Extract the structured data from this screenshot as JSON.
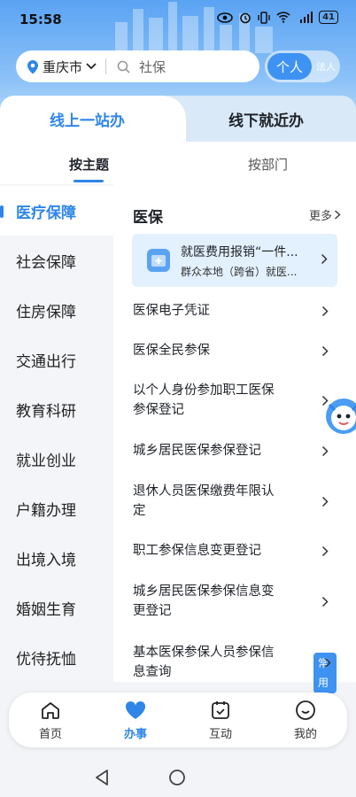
{
  "status_bar": {
    "time": "15:58",
    "battery": "41"
  },
  "search": {
    "city": "重庆市",
    "placeholder": "社保"
  },
  "role_toggle": {
    "active": "个人",
    "inactive": "法人"
  },
  "service_tabs": {
    "online": "线上一站办",
    "offline": "线下就近办"
  },
  "sub_tabs": {
    "by_topic": "按主题",
    "by_department": "按部门"
  },
  "sidebar": {
    "items": [
      {
        "label": "医疗保障"
      },
      {
        "label": "社会保障"
      },
      {
        "label": "住房保障"
      },
      {
        "label": "交通出行"
      },
      {
        "label": "教育科研"
      },
      {
        "label": "就业创业"
      },
      {
        "label": "户籍办理"
      },
      {
        "label": "出境入境"
      },
      {
        "label": "婚姻生育"
      },
      {
        "label": "优待抚恤"
      }
    ]
  },
  "main": {
    "section_title": "医保",
    "more": "更多",
    "featured": {
      "title": "就医费用报销“一件...",
      "subtitle": "群众本地（跨省）就医..."
    },
    "items": [
      {
        "line1": "医保电子凭证"
      },
      {
        "line1": "医保全民参保"
      },
      {
        "line1": "以个人身份参加职工医保",
        "line2": "参保登记"
      },
      {
        "line1": "城乡居民医保参保登记"
      },
      {
        "line1": "退休人员医保缴费年限认",
        "line2": "定"
      },
      {
        "line1": "职工参保信息变更登记"
      },
      {
        "line1": "城乡居民医保参保信息变",
        "line2": "更登记"
      },
      {
        "line1": "基本医保参保人员参保信",
        "line2": "息查询",
        "badge": "常用"
      }
    ]
  },
  "bottom_nav": {
    "items": [
      {
        "label": "首页",
        "icon": "home-icon"
      },
      {
        "label": "办事",
        "icon": "heart-icon"
      },
      {
        "label": "互动",
        "icon": "calendar-check-icon"
      },
      {
        "label": "我的",
        "icon": "smile-icon"
      }
    ]
  },
  "colors": {
    "accent": "#2f86e8",
    "feature_bg": "#e3f0fd"
  }
}
